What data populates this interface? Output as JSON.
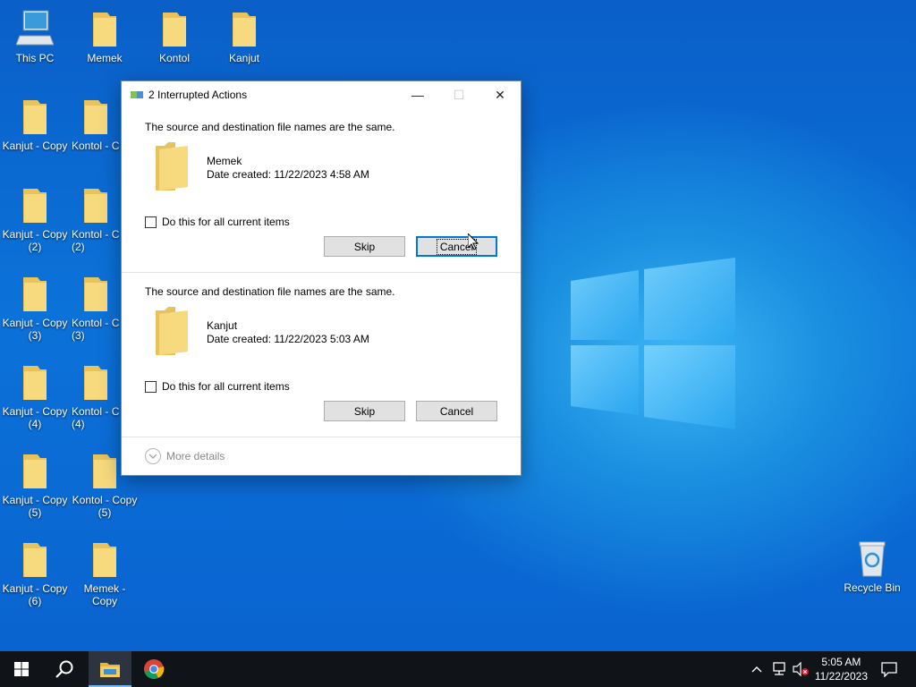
{
  "desktop": {
    "icons": [
      {
        "label": "This PC",
        "icon": "computer-icon"
      },
      {
        "label": "Memek",
        "icon": "folder-icon"
      },
      {
        "label": "Kontol",
        "icon": "folder-icon"
      },
      {
        "label": "Kanjut",
        "icon": "folder-icon"
      },
      {
        "label": "Kanjut - Copy",
        "icon": "folder-icon"
      },
      {
        "label": "Kontol - C",
        "icon": "folder-icon"
      },
      {
        "label": "Kanjut - Copy (2)",
        "icon": "folder-icon"
      },
      {
        "label": "Kontol - C (2)",
        "icon": "folder-icon"
      },
      {
        "label": "Kanjut - Copy (3)",
        "icon": "folder-icon"
      },
      {
        "label": "Kontol - C (3)",
        "icon": "folder-icon"
      },
      {
        "label": "Kanjut - Copy (4)",
        "icon": "folder-icon"
      },
      {
        "label": "Kontol - C (4)",
        "icon": "folder-icon"
      },
      {
        "label": "Kanjut - Copy (5)",
        "icon": "folder-icon"
      },
      {
        "label": "Kontol - Copy (5)",
        "icon": "folder-icon"
      },
      {
        "label": "Kanjut - Copy (6)",
        "icon": "folder-icon"
      },
      {
        "label": "Memek - Copy",
        "icon": "folder-icon"
      },
      {
        "label": "Recycle Bin",
        "icon": "recycle-bin-icon"
      }
    ]
  },
  "dialog": {
    "title": "2 Interrupted Actions",
    "items": [
      {
        "message": "The source and destination file names are the same.",
        "name": "Memek",
        "date": "Date created: 11/22/2023 4:58 AM",
        "checkbox_label": "Do this for all current items",
        "skip_label": "Skip",
        "cancel_label": "Cancel"
      },
      {
        "message": "The source and destination file names are the same.",
        "name": "Kanjut",
        "date": "Date created: 11/22/2023 5:03 AM",
        "checkbox_label": "Do this for all current items",
        "skip_label": "Skip",
        "cancel_label": "Cancel"
      }
    ],
    "more_details": "More details"
  },
  "taskbar": {
    "time": "5:05 AM",
    "date": "11/22/2023"
  },
  "colors": {
    "folder": "#f5d77a",
    "taskbar": "#101318",
    "accent": "#0078d7"
  }
}
